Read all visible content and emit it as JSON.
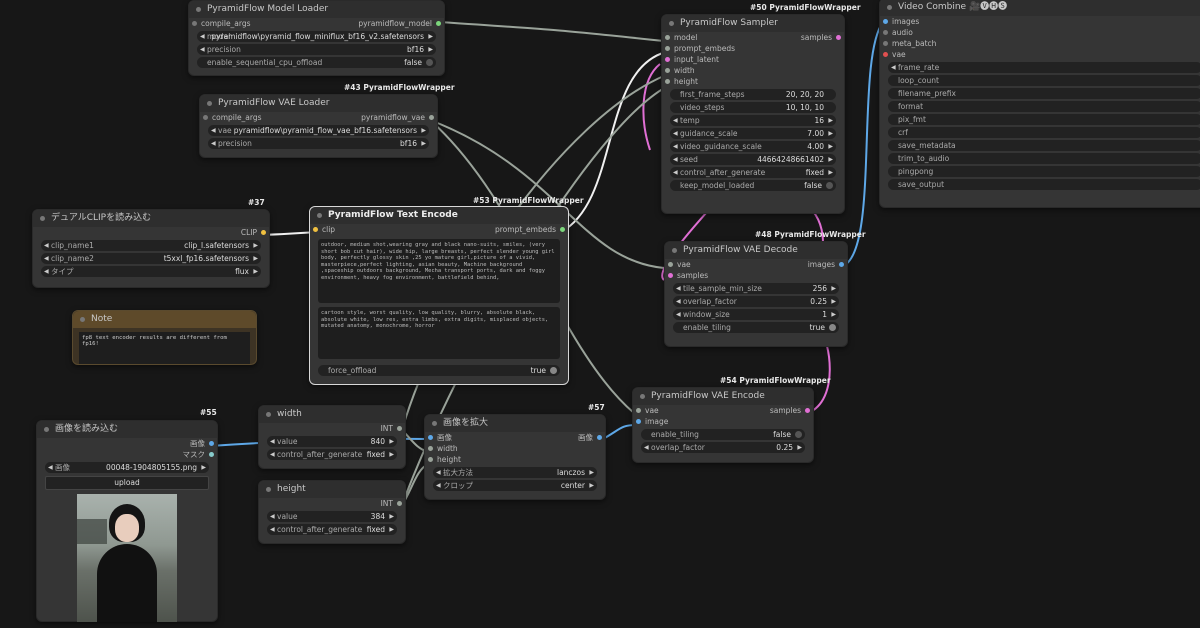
{
  "colors": {
    "bg": "#171717",
    "node": "#353535",
    "accent_green": "#7cd67c",
    "wire_pink": "#e06fd4",
    "wire_blue": "#5ea8e8",
    "wire_gray": "#9aa39a"
  },
  "model_loader": {
    "title": "PyramidFlow Model Loader",
    "input": "compile_args",
    "output": "pyramidflow_model",
    "model_label": "model",
    "model_value": "pyramidflow\\pyramid_flow_miniflux_bf16_v2.safetensors",
    "precision_label": "precision",
    "precision_value": "bf16",
    "offload_label": "enable_sequential_cpu_offload",
    "offload_value": "false"
  },
  "vae_loader": {
    "badge": "#43 PyramidFlowWrapper",
    "title": "PyramidFlow VAE Loader",
    "input": "compile_args",
    "output": "pyramidflow_vae",
    "vae_label": "vae",
    "vae_value": "pyramidflow\\pyramid_flow_vae_bf16.safetensors",
    "precision_label": "precision",
    "precision_value": "bf16"
  },
  "sampler": {
    "badge": "#50 PyramidFlowWrapper",
    "title": "PyramidFlow Sampler",
    "inputs": [
      "model",
      "prompt_embeds",
      "input_latent",
      "width",
      "height"
    ],
    "output": "samples",
    "widgets": [
      {
        "label": "first_frame_steps",
        "value": "20, 20, 20"
      },
      {
        "label": "video_steps",
        "value": "10, 10, 10"
      },
      {
        "label": "temp",
        "value": "16"
      },
      {
        "label": "guidance_scale",
        "value": "7.00"
      },
      {
        "label": "video_guidance_scale",
        "value": "4.00"
      },
      {
        "label": "seed",
        "value": "44664248661402"
      },
      {
        "label": "control_after_generate",
        "value": "fixed"
      }
    ],
    "keep_label": "keep_model_loaded",
    "keep_value": "false"
  },
  "video_combine": {
    "title": "Video Combine 🎥🅥🅗🅢",
    "inputs": [
      "images",
      "audio",
      "meta_batch",
      "vae"
    ],
    "widgets": [
      "frame_rate",
      "loop_count",
      "filename_prefix",
      "format",
      "pix_fmt",
      "crf",
      "save_metadata",
      "trim_to_audio",
      "pingpong",
      "save_output"
    ]
  },
  "dual_clip": {
    "badge": "#37",
    "title": "デュアルCLIPを読み込む",
    "output": "CLIP",
    "clip1_label": "clip_name1",
    "clip1_value": "clip_l.safetensors",
    "clip2_label": "clip_name2",
    "clip2_value": "t5xxl_fp16.safetensors",
    "type_label": "タイプ",
    "type_value": "flux"
  },
  "note": {
    "title": "Note",
    "text": "fp8 text encoder results are different from fp16!"
  },
  "text_encode": {
    "badge": "#53 PyramidFlowWrapper",
    "title": "PyramidFlow Text Encode",
    "input": "clip",
    "output": "prompt_embeds",
    "positive": "outdoor, medium shot,wearing gray and black nano-suits, smiles, (very short bob cut hair), wide hip, large breasts, perfect slender young girl body, perfectly glossy skin ,25 yo mature girl,picture of a vivid, masterpiece,perfect lighting, asian beauty, Machine background ,spaceship outdoors background, Mecha transport ports, dark and foggy environment, heavy fog environment, battlefield behind,",
    "negative": "cartoon style, worst quality, low quality, blurry, absolute black, absolute white, low res, extra limbs, extra digits, misplaced objects, mutated anatomy, monochrome, horror",
    "offload_label": "force_offload",
    "offload_value": "true"
  },
  "vae_decode": {
    "badge": "#48 PyramidFlowWrapper",
    "title": "PyramidFlow VAE Decode",
    "inputs": [
      "vae",
      "samples"
    ],
    "output": "images",
    "widgets": [
      {
        "label": "tile_sample_min_size",
        "value": "256"
      },
      {
        "label": "overlap_factor",
        "value": "0.25"
      },
      {
        "label": "window_size",
        "value": "1"
      }
    ],
    "tiling_label": "enable_tiling",
    "tiling_value": "true"
  },
  "vae_encode": {
    "badge": "#54 PyramidFlowWrapper",
    "title": "PyramidFlow VAE Encode",
    "inputs": [
      "vae",
      "image"
    ],
    "output": "samples",
    "tiling_label": "enable_tiling",
    "tiling_value": "false",
    "overlap_label": "overlap_factor",
    "overlap_value": "0.25"
  },
  "load_image": {
    "badge": "#55",
    "title": "画像を読み込む",
    "outputs": [
      "画像",
      "マスク"
    ],
    "image_label": "画像",
    "image_value": "00048-1904805155.png",
    "upload_label": "upload"
  },
  "width_node": {
    "title": "width",
    "output": "INT",
    "value_label": "value",
    "value": "840",
    "control_label": "control_after_generate",
    "control_value": "fixed"
  },
  "height_node": {
    "title": "height",
    "output": "INT",
    "value_label": "value",
    "value": "384",
    "control_label": "control_after_generate",
    "control_value": "fixed"
  },
  "upscale": {
    "badge": "#57",
    "title": "画像を拡大",
    "inputs": [
      "画像",
      "width",
      "height"
    ],
    "output": "画像",
    "method_label": "拡大方法",
    "method_value": "lanczos",
    "crop_label": "クロップ",
    "crop_value": "center"
  }
}
